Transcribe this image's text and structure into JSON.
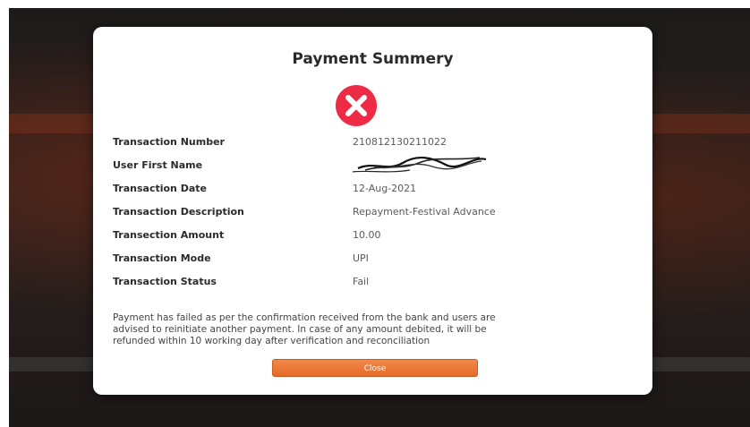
{
  "modal": {
    "title": "Payment Summery",
    "status_icon": "failure-x-icon",
    "status_color": "#ef2a44",
    "rows": [
      {
        "label": "Transaction Number",
        "value": "210812130211022"
      },
      {
        "label": "User First Name",
        "value": ""
      },
      {
        "label": "Transaction Date",
        "value": "12-Aug-2021"
      },
      {
        "label": "Transaction Description",
        "value": "Repayment-Festival Advance"
      },
      {
        "label": "Transection Amount",
        "value": "10.00"
      },
      {
        "label": "Transaction Mode",
        "value": "UPI"
      },
      {
        "label": "Transaction Status",
        "value": "Fail"
      }
    ],
    "message_lines": [
      "Payment has failed as per the confirmation received from the bank and users are",
      "advised to reinitiate another payment. In case of any amount debited, it will be",
      "refunded within 10 working day after verification and reconciliation"
    ],
    "close_label": "Close",
    "button_color": "#ee7a3a"
  }
}
